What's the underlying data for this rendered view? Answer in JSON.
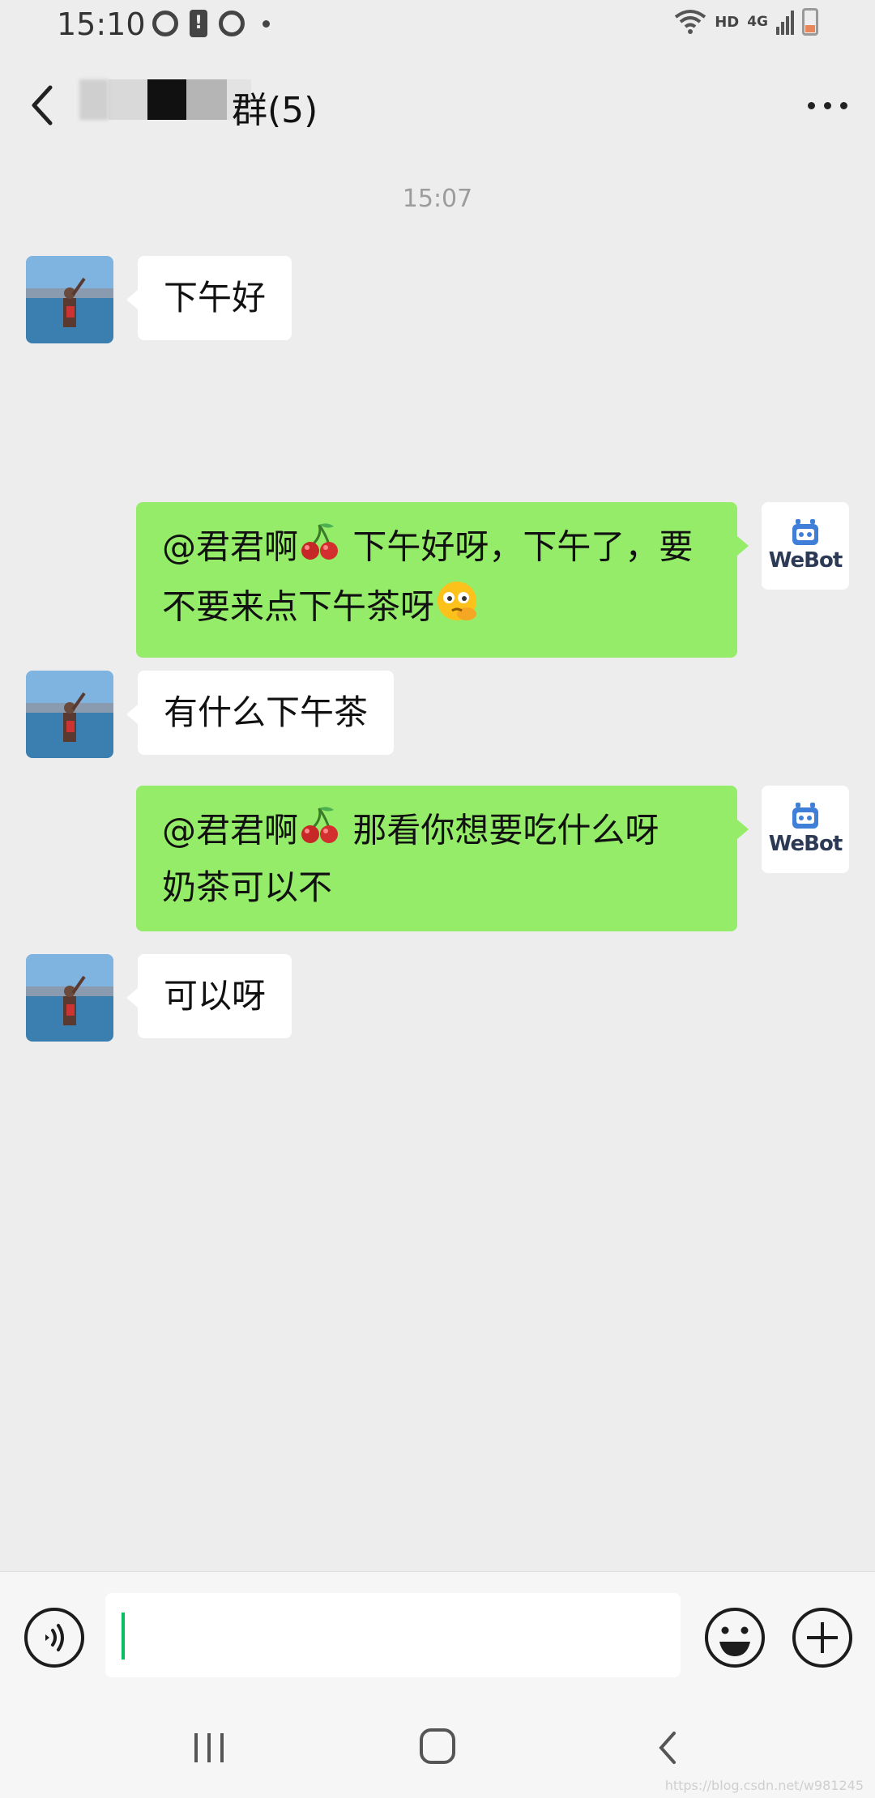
{
  "status_bar": {
    "time": "15:10",
    "network_label": "HD",
    "network_type": "4G",
    "battery_color": "#e8885a"
  },
  "header": {
    "title": "群(5)",
    "back_icon": "chevron-left-icon",
    "more_icon": "more-horizontal-icon"
  },
  "chat": {
    "timestamp": "15:07",
    "messages": [
      {
        "direction": "incoming",
        "text": "下午好"
      },
      {
        "direction": "outgoing",
        "sender_avatar_label": "WeBot",
        "mention": "@君君啊",
        "line1": "下午好呀，下午了，要",
        "line2": "不要来点下午茶呀",
        "emojis": [
          "cherry-emoji",
          "thinking-face-emoji"
        ]
      },
      {
        "direction": "incoming",
        "text": "有什么下午茶"
      },
      {
        "direction": "outgoing",
        "sender_avatar_label": "WeBot",
        "mention": "@君君啊",
        "line1": "那看你想要吃什么呀",
        "line2": "奶茶可以不",
        "emojis": [
          "cherry-emoji"
        ]
      },
      {
        "direction": "incoming",
        "text": "可以呀"
      }
    ]
  },
  "input_bar": {
    "input_value": "",
    "voice_icon": "voice-icon",
    "emoji_icon": "emoji-icon",
    "plus_icon": "plus-icon",
    "caret_color": "#07c160"
  },
  "nav_bar": {
    "recent_icon": "recent-apps-icon",
    "home_icon": "home-icon",
    "back_icon": "back-icon"
  },
  "watermark": "https://blog.csdn.net/w981245",
  "colors": {
    "background": "#ededed",
    "outgoing_bubble": "#95ec69",
    "incoming_bubble": "#ffffff"
  }
}
